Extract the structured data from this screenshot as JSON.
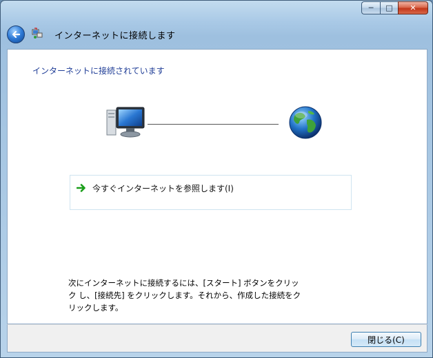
{
  "window": {
    "title": "インターネットに接続します",
    "controls": {
      "minimize": "─",
      "maximize": "□",
      "close": "✕"
    }
  },
  "content": {
    "heading": "インターネットに接続されています",
    "browse_option": "今すぐインターネットを参照します(I)",
    "instructions": {
      "line1": "次にインターネットに接続するには、[スタート] ボタンをクリッ",
      "line2": "ク し、[接続先] をクリックします。それから、作成した接続をク",
      "line3": "リックします。"
    }
  },
  "footer": {
    "close_button": "閉じる(C)"
  },
  "colors": {
    "heading": "#1e3c96",
    "arrow": "#1a9e1a",
    "button_border": "#3c7fb1"
  }
}
